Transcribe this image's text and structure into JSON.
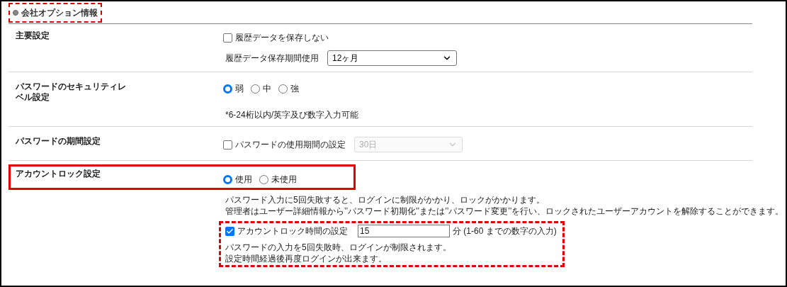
{
  "title": {
    "text": "会社オプション情報",
    "highlighted": true
  },
  "sections": [
    {
      "label": "主要設定",
      "highlighted": false,
      "controls": [
        {
          "kind": "checkbox",
          "label": "履歴データを保存しない",
          "checked": false
        },
        {
          "kind": "select",
          "label": "履歴データ保存期間使用",
          "value": "12ヶ月",
          "disabled": false
        }
      ]
    },
    {
      "label": "パスワードのセキュリティレベル設定",
      "highlighted": false,
      "controls": [
        {
          "kind": "radio_group",
          "options": [
            {
              "label": "弱",
              "selected": true
            },
            {
              "label": "中",
              "selected": false
            },
            {
              "label": "強",
              "selected": false
            }
          ]
        },
        {
          "kind": "note",
          "lines": [
            "*6-24桁以内/英字及び数字入力可能"
          ]
        }
      ]
    },
    {
      "label": "パスワードの期間設定",
      "highlighted": false,
      "controls": [
        {
          "kind": "checkbox_select",
          "label": "パスワードの使用期間の設定",
          "checked": false,
          "value": "30日",
          "disabled": true
        }
      ]
    },
    {
      "label": "アカウントロック設定",
      "highlighted": true,
      "controls": [
        {
          "kind": "radio_group",
          "options": [
            {
              "label": "使用",
              "selected": true
            },
            {
              "label": "未使用",
              "selected": false
            }
          ]
        },
        {
          "kind": "note",
          "lines": [
            "パスワード入力に5回失敗すると、ログインに制限がかかり、ロックがかかります。",
            "管理者はユーザー詳細情報から’’パスワード初期化’’または’’パスワード変更’’を行い、ロックされたユーザーアカウントを解除することができます。"
          ]
        },
        {
          "kind": "group",
          "highlighted": true,
          "items": [
            {
              "kind": "checkbox_input",
              "label": "アカウントロック時間の設定",
              "checked": true,
              "value": "15",
              "suffix": "分 (1-60 までの数字の入力)"
            },
            {
              "kind": "note",
              "lines": [
                "パスワードの入力を5回失敗時、ログインが制限されます。",
                "設定時間経過後再度ログインが出来ます。"
              ]
            }
          ]
        }
      ]
    }
  ]
}
